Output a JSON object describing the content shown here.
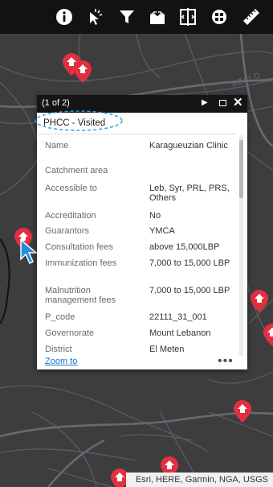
{
  "toolbar": {
    "buttons": [
      {
        "icon": "info-icon"
      },
      {
        "icon": "select-cursor-icon"
      },
      {
        "icon": "filter-icon"
      },
      {
        "icon": "add-data-icon"
      },
      {
        "icon": "compare-layers-icon"
      },
      {
        "icon": "basemap-gallery-icon"
      },
      {
        "icon": "measure-ruler-icon"
      }
    ]
  },
  "map": {
    "street_label": "AZALO",
    "attribution": "Esri, HERE, Garmin, NGA, USGS",
    "marker_color": "#e0303f",
    "selection_color": "#2ec4e8"
  },
  "popup": {
    "counter": "(1 of 2)",
    "next_symbol": "▶",
    "close_symbol": "✕",
    "title": "PHCC - Visited",
    "zoom_to": "Zoom to",
    "more": "•••",
    "attributes": [
      {
        "name": "Name",
        "value": "Karagueuzian Clinic"
      },
      {
        "name": "Catchment area",
        "value": ""
      },
      {
        "name": "Accessible to",
        "value": "Leb, Syr, PRL, PRS, Others"
      },
      {
        "name": "Accreditation",
        "value": "No"
      },
      {
        "name": "Guarantors",
        "value": "YMCA"
      },
      {
        "name": "Consultation fees",
        "value": "above 15,000LBP"
      },
      {
        "name": "Immunization fees",
        "value": "7,000 to 15,000 LBP"
      },
      {
        "name": "Malnutrition management fees",
        "value": "7,000 to 15,000 LBP"
      },
      {
        "name": "P_code",
        "value": "22111_31_001"
      },
      {
        "name": "Governorate",
        "value": "Mount Lebanon"
      },
      {
        "name": "District",
        "value": "El Meten"
      }
    ]
  }
}
